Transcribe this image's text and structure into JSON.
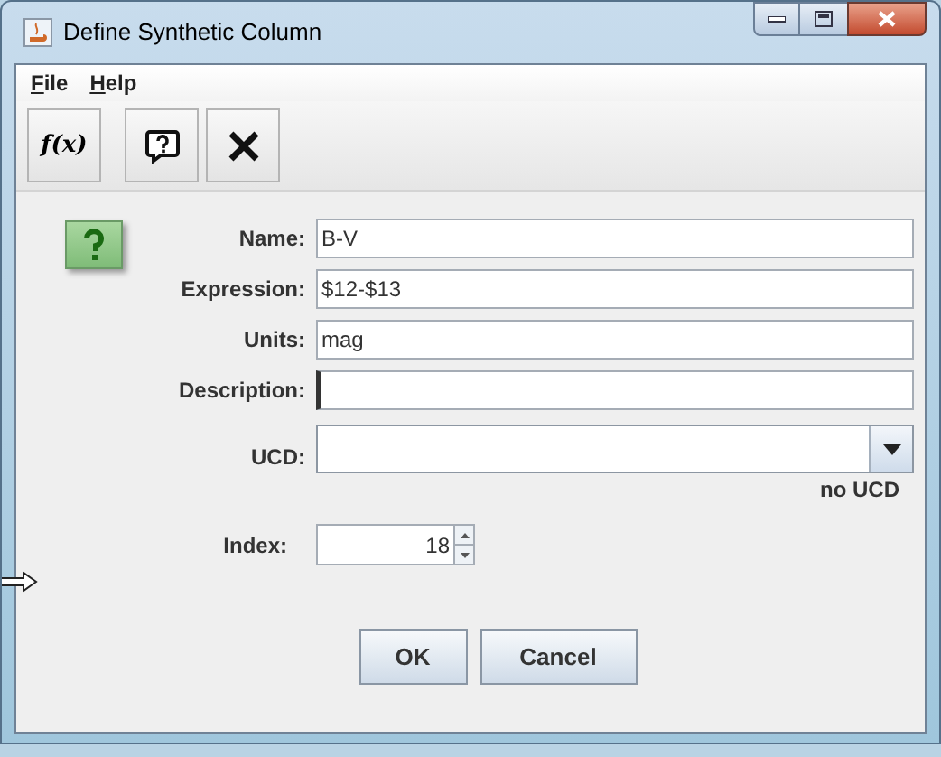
{
  "window": {
    "title": "Define Synthetic Column"
  },
  "menu": [
    {
      "label": "File"
    },
    {
      "label": "Help"
    }
  ],
  "toolbar": [
    {
      "kind": "function",
      "label": "f(x)"
    },
    {
      "kind": "help"
    },
    {
      "kind": "close"
    }
  ],
  "form": {
    "fields": [
      {
        "label": "Name:",
        "value": "B-V"
      },
      {
        "label": "Expression:",
        "value": "$12-$13"
      },
      {
        "label": "Units:",
        "value": "mag"
      },
      {
        "label": "Description:",
        "focused": true
      }
    ],
    "ucd": {
      "label": "UCD:",
      "note": "no UCD"
    },
    "index": {
      "label": "Index:",
      "value": "18"
    }
  },
  "buttons": [
    {
      "label": "OK"
    },
    {
      "label": "Cancel"
    }
  ]
}
